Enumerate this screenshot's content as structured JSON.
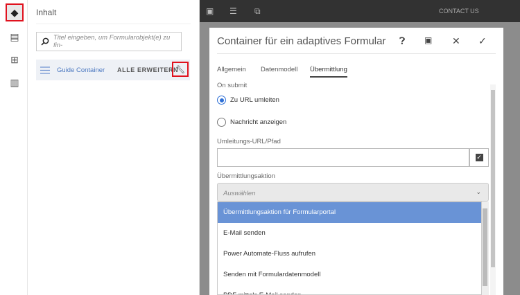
{
  "rail": {
    "icons": [
      "layers-icon",
      "assets-icon",
      "components-icon",
      "content-tree-icon"
    ]
  },
  "panel": {
    "title": "Inhalt",
    "search_placeholder": "Titel eingeben, um Formularobjekt(e) zu fin-",
    "tree_item": "Guide Container",
    "expand_all": "ALLE ERWEITERN"
  },
  "topbar": {
    "contact": "CONTACT US"
  },
  "dialog": {
    "title": "Container für ein adaptives Formular",
    "tabs": [
      "Allgemein",
      "Datenmodell",
      "Übermittlung"
    ],
    "on_submit": "On submit",
    "radio1": "Zu URL umleiten",
    "radio2": "Nachricht anzeigen",
    "url_label": "Umleitungs-URL/Pfad",
    "url_value": "",
    "action_label": "Übermittlungsaktion",
    "action_placeholder": "Auswählen",
    "options": [
      "Übermittlungsaktion für Formularportal",
      "E-Mail senden",
      "Power Automate-Fluss aufrufen",
      "Senden mit Formulardatenmodell",
      "PDF mittels E-Mail senden"
    ]
  },
  "colors": {
    "highlight": "#6993d6",
    "callout": "#e0121e",
    "topbar": "#323232"
  }
}
